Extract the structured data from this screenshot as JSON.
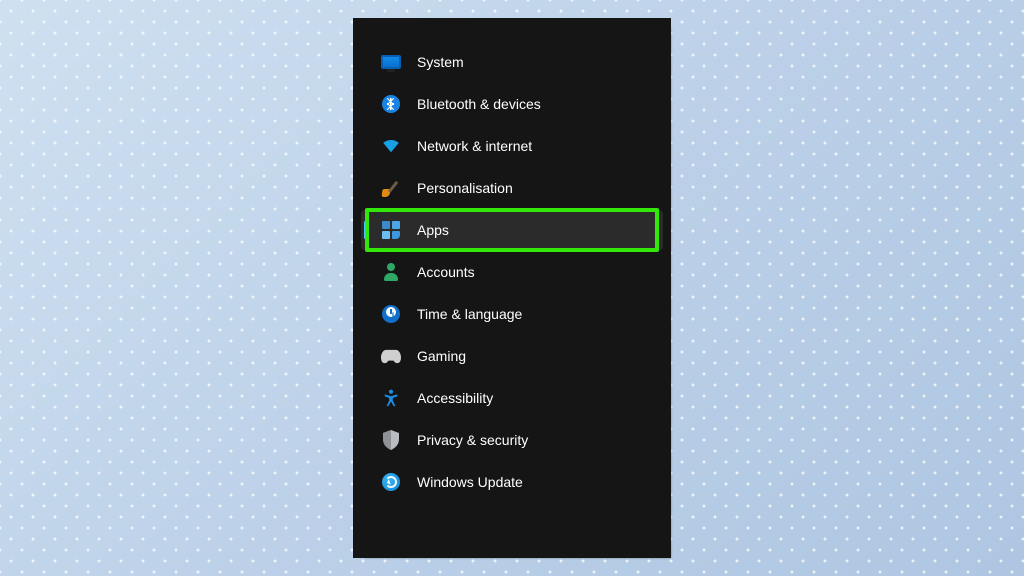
{
  "sidebar": {
    "selected_index": 4,
    "highlighted_index": 4,
    "items": [
      {
        "label": "System"
      },
      {
        "label": "Bluetooth & devices"
      },
      {
        "label": "Network & internet"
      },
      {
        "label": "Personalisation"
      },
      {
        "label": "Apps"
      },
      {
        "label": "Accounts"
      },
      {
        "label": "Time & language"
      },
      {
        "label": "Gaming"
      },
      {
        "label": "Accessibility"
      },
      {
        "label": "Privacy & security"
      },
      {
        "label": "Windows Update"
      }
    ]
  },
  "colors": {
    "accent": "#4cc2ff",
    "highlight_border": "#32e80b",
    "panel_bg": "#151515",
    "selected_bg": "#2b2b2b"
  }
}
